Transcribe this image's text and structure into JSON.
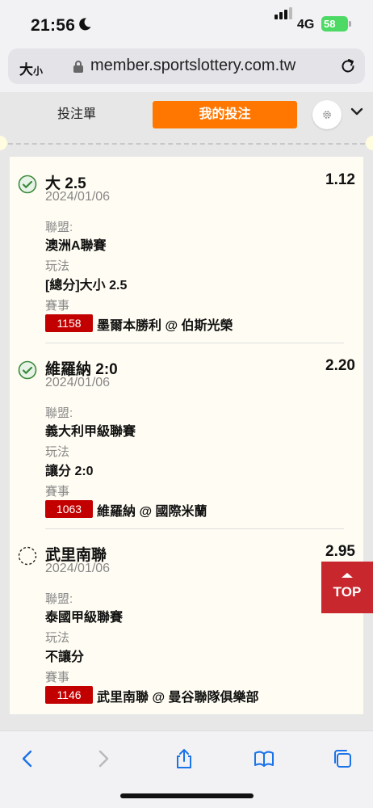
{
  "status": {
    "time": "21:56",
    "network": "4G",
    "battery": "58"
  },
  "browser": {
    "text_size_label": "大",
    "text_size_small": "小",
    "url": "member.sportslottery.com.tw"
  },
  "tabs": {
    "betslip": "投注單",
    "my_bets": "我的投注"
  },
  "labels": {
    "league": "聯盟:",
    "market": "玩法",
    "event": "賽事"
  },
  "bets": [
    {
      "selection": "大 2.5",
      "odds": "1.12",
      "date": "2024/01/06",
      "league": "澳洲A聯賽",
      "market": "[總分]大小 2.5",
      "match_id": "1158",
      "match": "墨爾本勝利 @ 伯斯光榮",
      "status": "won"
    },
    {
      "selection": "維羅納 2:0",
      "odds": "2.20",
      "date": "2024/01/06",
      "league": "義大利甲級聯賽",
      "market": "讓分 2:0",
      "match_id": "1063",
      "match": "維羅納 @ 國際米蘭",
      "status": "won"
    },
    {
      "selection": "武里南聯",
      "odds": "2.95",
      "date": "2024/01/06",
      "league": "泰國甲級聯賽",
      "market": "不讓分",
      "match_id": "1146",
      "match": "武里南聯 @ 曼谷聯隊俱樂部",
      "status": "pending"
    }
  ],
  "top_button": "TOP",
  "colors": {
    "accent": "#ff7700",
    "match_badge": "#c20000",
    "top_button": "#c8282d",
    "won_check": "#3a8a3a",
    "ios_blue": "#1a73e8"
  }
}
